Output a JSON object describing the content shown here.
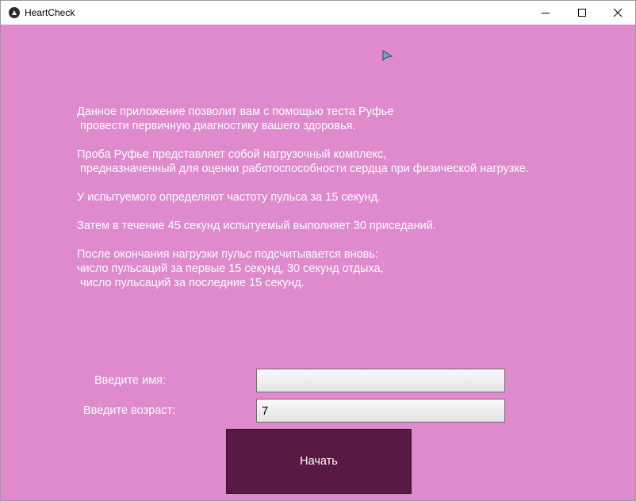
{
  "window": {
    "title": "HeartCheck",
    "app_icon": "kivy-icon",
    "controls": [
      "minimize-icon",
      "maximize-icon",
      "close-icon"
    ]
  },
  "main": {
    "description": "Данное приложение позволит вам с помощью теста Руфье\n провести первичную диагностику вашего здоровья.\n\nПроба Руфье представляет собой нагрузочный комплекс,\n предназначенный для оценки работоспособности сердца при физической нагрузке.\n\nУ испытуемого определяют частоту пульса за 15 секунд.\n\nЗатем в течение 45 секунд испытуемый выполняет 30 приседаний.\n\nПосле окончания нагрузки пульс подсчитывается вновь:\nчисло пульсаций за первые 15 секунд, 30 секунд отдыха,\n число пульсаций за последние 15 секунд.",
    "name_label": "Введите имя:",
    "name_value": "",
    "age_label": "Введите возраст:",
    "age_value": "7",
    "start_label": "Начать"
  },
  "colors": {
    "background": "#df8acc",
    "button": "#581943",
    "text": "#ffffff"
  }
}
